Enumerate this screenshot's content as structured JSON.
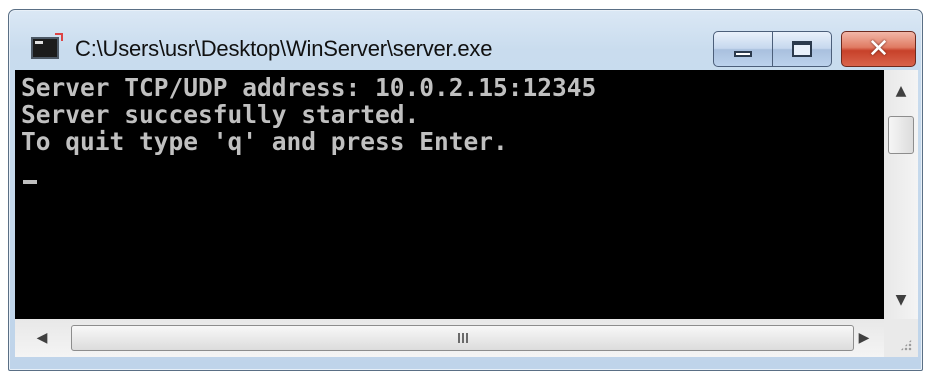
{
  "window": {
    "title": "C:\\Users\\usr\\Desktop\\WinServer\\server.exe"
  },
  "titlebar_buttons": {
    "minimize_icon": "minimize-icon",
    "maximize_icon": "maximize-icon",
    "close_glyph": "✕"
  },
  "console": {
    "lines": [
      "Server TCP/UDP address: 10.0.2.15:12345",
      "Server succesfully started.",
      "To quit type 'q' and press Enter."
    ],
    "background": "#000000",
    "foreground": "#c0c0c0"
  },
  "scrollbars": {
    "up_arrow": "▲",
    "down_arrow": "▼",
    "left_arrow": "◀",
    "right_arrow": "▶"
  },
  "colors": {
    "close_button": "#c7412a",
    "frame": "#bfd4ea"
  }
}
